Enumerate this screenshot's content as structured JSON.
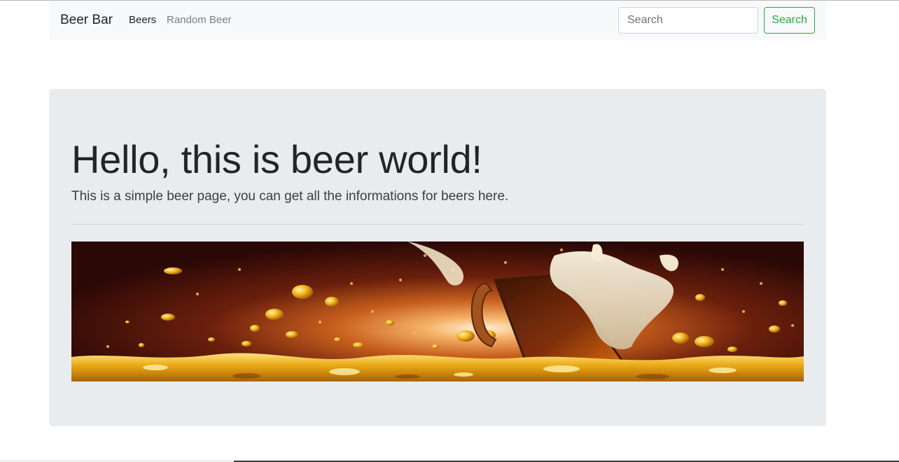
{
  "navbar": {
    "brand": "Beer Bar",
    "links": [
      {
        "label": "Beers",
        "active": true
      },
      {
        "label": "Random Beer",
        "active": false
      }
    ],
    "search": {
      "placeholder": "Search",
      "value": "",
      "button_label": "Search"
    }
  },
  "hero": {
    "title": "Hello, this is beer world!",
    "lead": "This is a simple beer page, you can get all the informations for beers here."
  },
  "colors": {
    "accent": "#28a745",
    "navbar_bg": "#f8f9fa",
    "jumbotron_bg": "#e9ecef"
  }
}
